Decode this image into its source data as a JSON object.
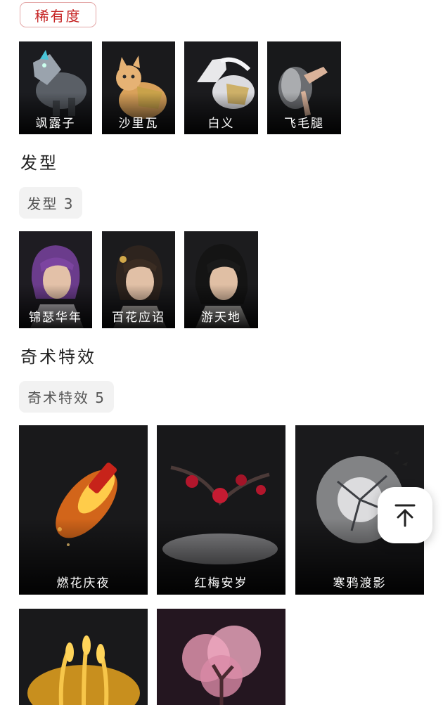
{
  "rarity": {
    "label": "稀有度"
  },
  "mounts": [
    {
      "name": "飒露子",
      "icon": "armored-horse-icon"
    },
    {
      "name": "沙里瓦",
      "icon": "cat-mount-icon"
    },
    {
      "name": "白义",
      "icon": "white-horse-icon"
    },
    {
      "name": "飞毛腿",
      "icon": "flying-legs-icon"
    }
  ],
  "hairstyle": {
    "heading": "发型",
    "chip": "发型 3",
    "items": [
      {
        "name": "锦瑟华年"
      },
      {
        "name": "百花应诏"
      },
      {
        "name": "游天地"
      }
    ]
  },
  "effects": {
    "heading": "奇术特效",
    "chip": "奇术特效 5",
    "items": [
      {
        "name": "燃花庆夜"
      },
      {
        "name": "红梅安岁"
      },
      {
        "name": "寒鸦渡影"
      },
      {
        "name": ""
      },
      {
        "name": ""
      }
    ]
  },
  "back_to_top": {
    "icon": "arrow-up-to-top-icon"
  },
  "colors": {
    "rarity_red": "#c62424",
    "chip_gray": "#f2f2f2",
    "tile_bg": "#141414"
  }
}
